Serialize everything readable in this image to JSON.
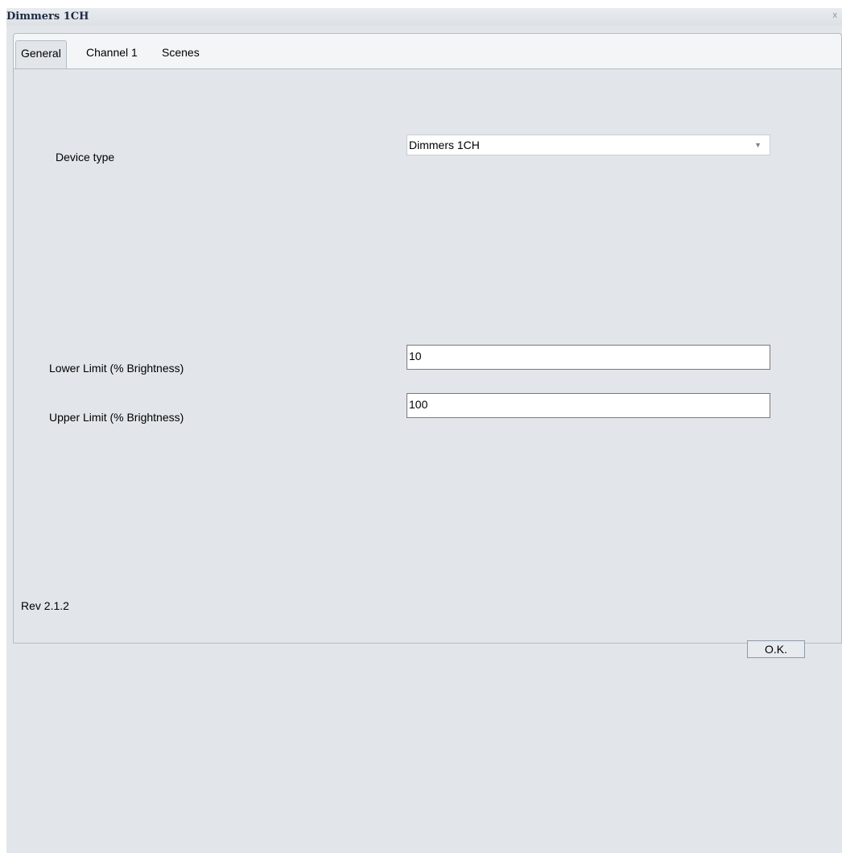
{
  "window": {
    "title": "Dimmers 1CH",
    "close_symbol": "x"
  },
  "tabs": [
    {
      "label": "General",
      "active": true
    },
    {
      "label": "Channel 1",
      "active": false
    },
    {
      "label": "Scenes",
      "active": false
    }
  ],
  "general": {
    "device_type_label": "Device type",
    "device_type_value": "Dimmers 1CH",
    "lower_limit_label": "Lower Limit (% Brightness)",
    "lower_limit_value": "10",
    "upper_limit_label": "Upper Limit (% Brightness)",
    "upper_limit_value": "100"
  },
  "footer": {
    "revision": "Rev 2.1.2",
    "ok_label": "O.K."
  }
}
